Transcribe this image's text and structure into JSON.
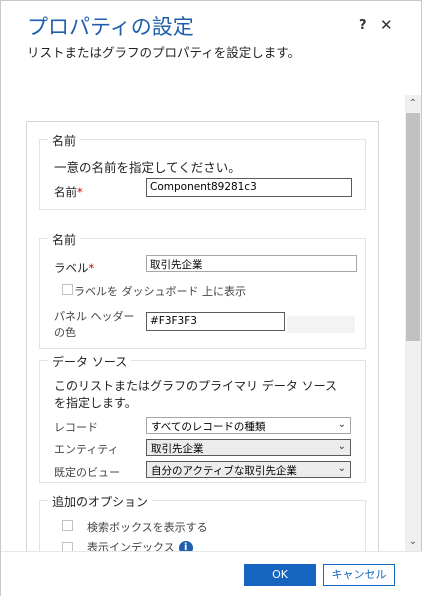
{
  "dialog": {
    "title": "プロパティの設定",
    "subtitle": "リストまたはグラフのプロパティを設定します。",
    "help_label": "?",
    "close_label": "✕"
  },
  "name_section": {
    "legend": "名前",
    "instruction": "一意の名前を指定してください。",
    "name_label": "名前",
    "required_mark": "*",
    "name_value": "Component89281c3"
  },
  "label_section": {
    "legend": "名前",
    "label_label": "ラベル",
    "required_mark": "*",
    "label_value": "取引先企業",
    "show_on_dashboard_label": "ラベルを ダッシュボード 上に表示",
    "panel_header_color_label_1": "パネル ヘッダー",
    "panel_header_color_label_2": "の色",
    "panel_header_color_value": "#F3F3F3"
  },
  "data_source_section": {
    "legend": "データ ソース",
    "description_1": "このリストまたはグラフのプライマリ データ ソース",
    "description_2": "を指定します。",
    "record_label": "レコード",
    "record_value": "すべてのレコードの種類",
    "entity_label": "エンティティ",
    "entity_value": "取引先企業",
    "default_view_label": "既定のビュー",
    "default_view_value": "自分のアクティブな取引先企業"
  },
  "additional_options_section": {
    "legend": "追加のオプション",
    "show_search_box_label": "検索ボックスを表示する",
    "show_index_label": "表示インデックス"
  },
  "footer": {
    "ok_label": "OK",
    "cancel_label": "キャンセル"
  },
  "icons": {
    "chevron": "⌄",
    "scroll_up": "⌃",
    "scroll_down": "⌄",
    "info": "i"
  }
}
